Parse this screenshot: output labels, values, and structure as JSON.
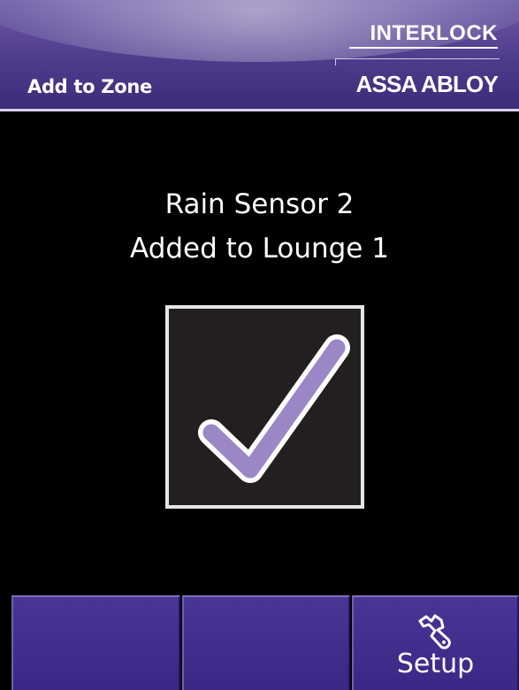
{
  "header": {
    "title": "Add to Zone",
    "brand_primary": "INTERLOCK",
    "brand_secondary": "ASSA ABLOY"
  },
  "message": {
    "line1": "Rain Sensor 2",
    "line2": "Added to Lounge 1"
  },
  "confirmation": {
    "icon": "checkmark-icon",
    "check_color": "#9b86c6"
  },
  "buttons": [
    {
      "label": ""
    },
    {
      "label": ""
    },
    {
      "label": "Setup",
      "icon": "wrench-icon"
    }
  ],
  "colors": {
    "header_purple": "#4f3b8c",
    "button_purple": "#4a3595",
    "background": "#000000"
  }
}
